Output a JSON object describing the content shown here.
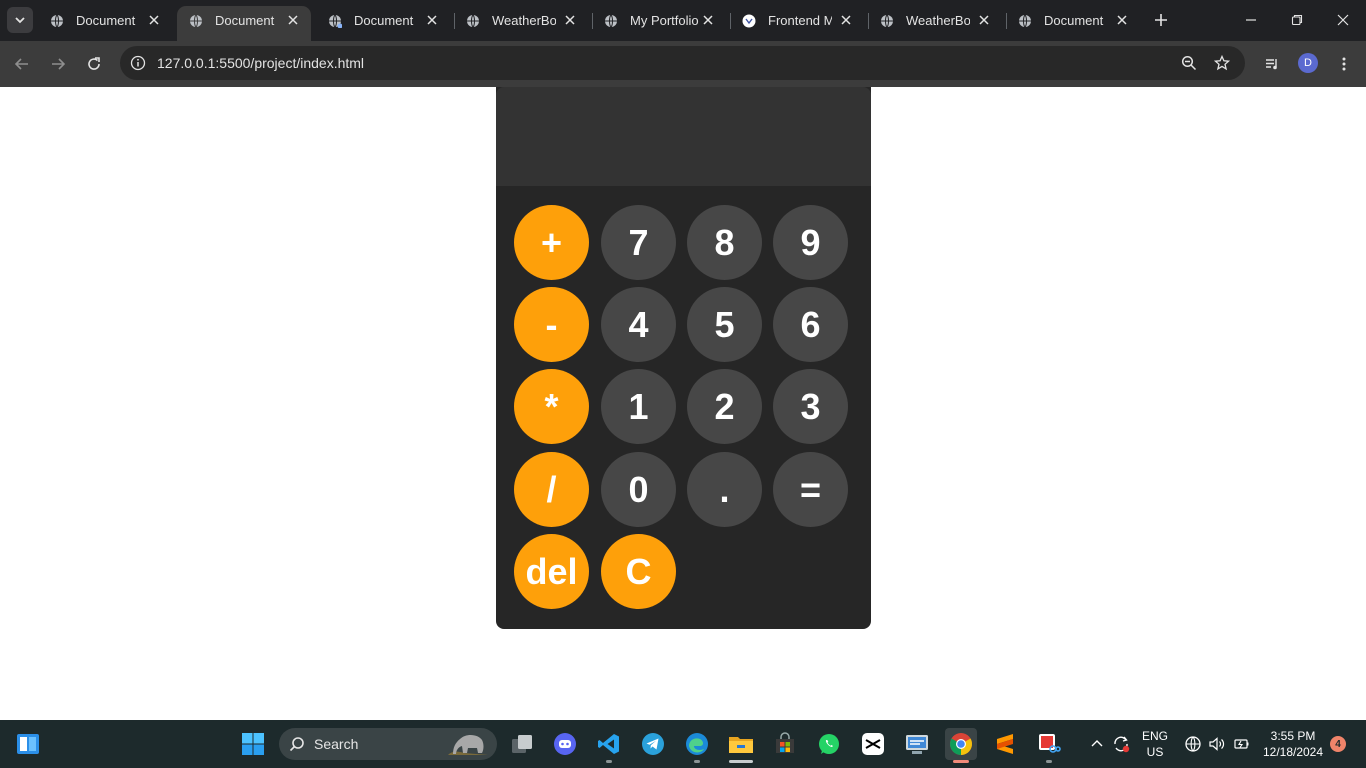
{
  "browser": {
    "tabs": [
      {
        "title": "Document",
        "active": false,
        "favicon": "globe-icon"
      },
      {
        "title": "Document",
        "active": true,
        "favicon": "globe-icon"
      },
      {
        "title": "Document",
        "active": false,
        "favicon": "globe-icon"
      },
      {
        "title": "WeatherBot",
        "active": false,
        "favicon": "globe-icon"
      },
      {
        "title": "My Portfolio",
        "active": false,
        "favicon": "globe-icon"
      },
      {
        "title": "Frontend Me",
        "active": false,
        "favicon": "frontend-mentor-icon"
      },
      {
        "title": "WeatherBot",
        "active": false,
        "favicon": "globe-icon"
      },
      {
        "title": "Document",
        "active": false,
        "favicon": "globe-icon"
      }
    ],
    "url_host": "127.0.0.1",
    "url_rest": ":5500/project/index.html",
    "profile_initial": "D"
  },
  "calculator": {
    "display_value": "",
    "keys": {
      "plus": "+",
      "seven": "7",
      "eight": "8",
      "nine": "9",
      "minus": "-",
      "four": "4",
      "five": "5",
      "six": "6",
      "multiply": "*",
      "one": "1",
      "two": "2",
      "three": "3",
      "divide": "/",
      "zero": "0",
      "decimal": ".",
      "equals": "=",
      "delete": "del",
      "clear": "C"
    },
    "colors": {
      "operator": "#fea00a",
      "number": "#474747",
      "body": "#262626",
      "display": "#333333"
    }
  },
  "taskbar": {
    "search_label": "Search",
    "language": "ENG",
    "region": "US",
    "time": "3:55 PM",
    "date": "12/18/2024",
    "notification_count": "4"
  }
}
